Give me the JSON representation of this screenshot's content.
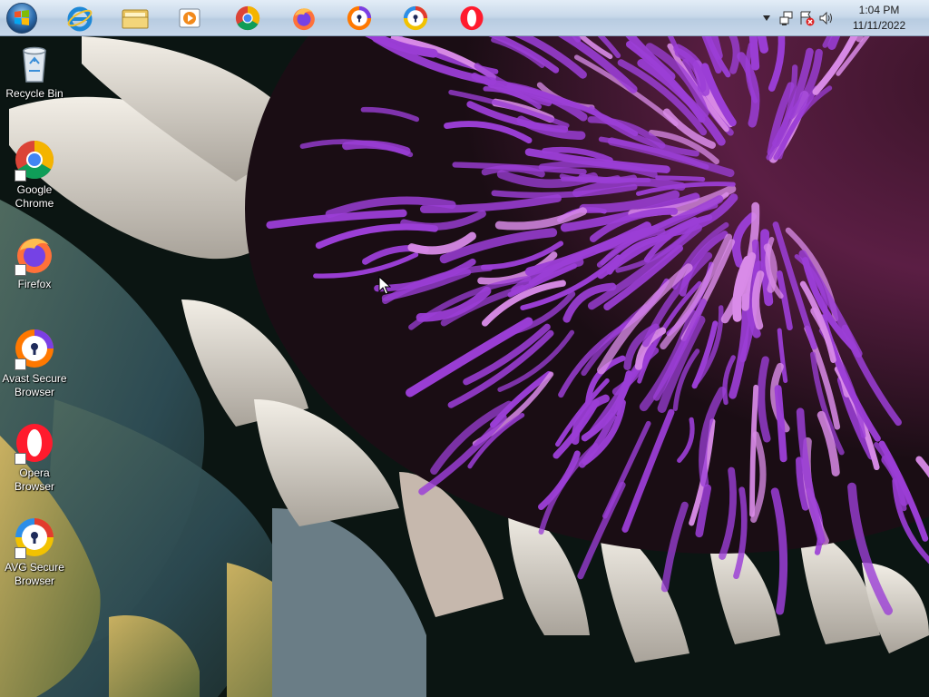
{
  "taskbar": {
    "start": {
      "icon": "windows-logo-icon"
    },
    "pinned": [
      {
        "id": "ie",
        "icon": "internet-explorer-icon"
      },
      {
        "id": "explorer",
        "icon": "folder-icon"
      },
      {
        "id": "media",
        "icon": "media-player-icon"
      },
      {
        "id": "chrome",
        "icon": "chrome-icon"
      },
      {
        "id": "firefox",
        "icon": "firefox-icon"
      },
      {
        "id": "avast",
        "icon": "avast-secure-browser-icon"
      },
      {
        "id": "avg",
        "icon": "avg-secure-browser-icon"
      },
      {
        "id": "opera",
        "icon": "opera-icon"
      }
    ],
    "tray": {
      "icons": [
        "show-hidden-icons-arrow-icon",
        "network-icon",
        "flag-error-icon",
        "volume-icon"
      ],
      "time": "1:04 PM",
      "date": "11/11/2022"
    }
  },
  "desktop": {
    "icons": [
      {
        "label": "Recycle Bin",
        "icon": "recycle-bin-icon"
      },
      {
        "label": "Google Chrome",
        "icon": "chrome-icon"
      },
      {
        "label": "Firefox",
        "icon": "firefox-icon"
      },
      {
        "label": "Avast Secure Browser",
        "icon": "avast-secure-browser-icon"
      },
      {
        "label": "Opera Browser",
        "icon": "opera-icon"
      },
      {
        "label": "AVG Secure Browser",
        "icon": "avg-secure-browser-icon"
      }
    ]
  },
  "colors": {
    "taskbar": "#c9d9ea",
    "petals": "#9b3ed6",
    "petal_tip": "#d98be8",
    "bracts": "#e8e2d8",
    "background": "#0a1410"
  }
}
